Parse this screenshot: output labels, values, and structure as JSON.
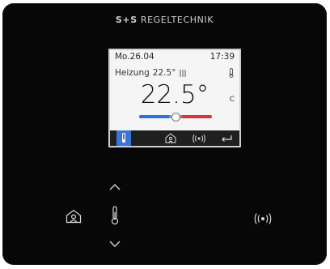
{
  "brand": {
    "part_a": "S+S",
    "part_b": "REGELTECHNIK"
  },
  "display": {
    "date": "Mo.26.04",
    "time": "17:39",
    "mode_label": "Heizung",
    "setpoint": "22.5°",
    "temperature": "22.5°",
    "unit": "C"
  },
  "icons": {
    "thermometer": "thermometer-icon",
    "presence": "presence-house-icon",
    "wireless": "wireless-icon",
    "back": "return-arrow-icon",
    "up": "chevron-up-icon",
    "down": "chevron-down-icon"
  },
  "colors": {
    "accent_blue": "#3b73d9",
    "heat_red": "#d9333b",
    "panel": "#070707",
    "screen_bg": "#f5f5f5"
  }
}
